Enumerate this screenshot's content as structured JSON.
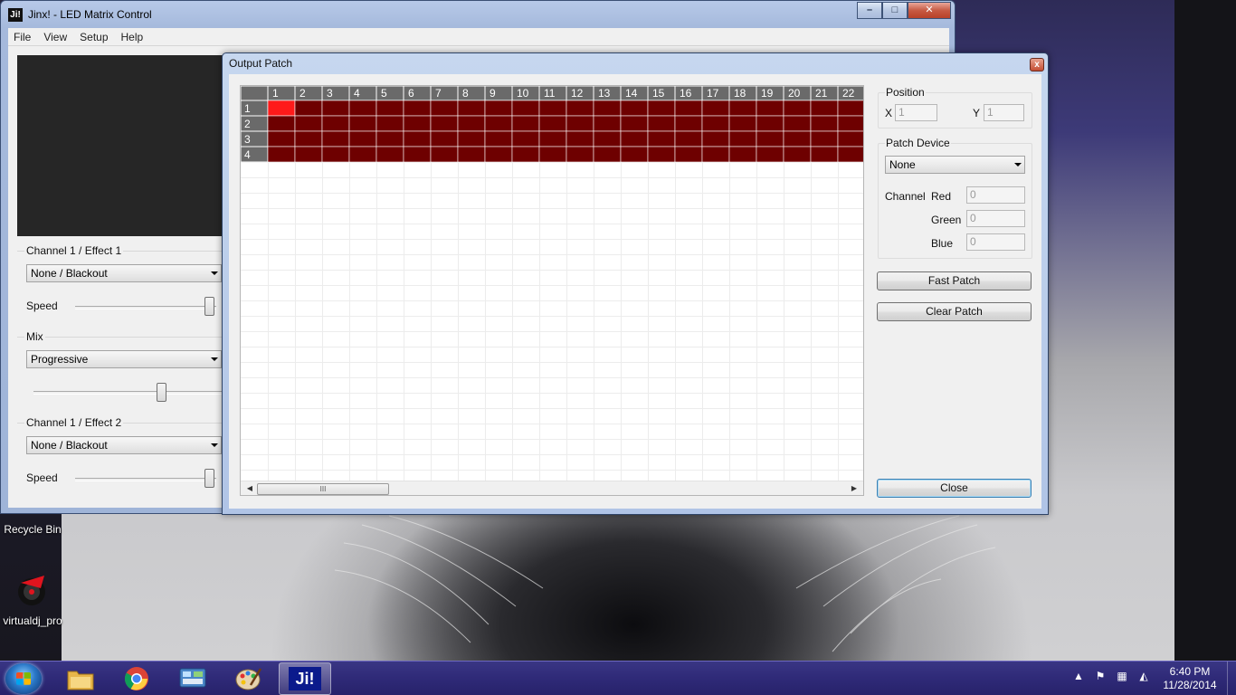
{
  "desktop": {
    "icons": [
      {
        "label": "Recycle Bin",
        "icon": "recycle-bin-icon"
      },
      {
        "label": "virtualdj_pro",
        "icon": "virtualdj-icon"
      }
    ]
  },
  "main_window": {
    "title": "Jinx! - LED Matrix Control",
    "logo_text": "Ji!",
    "menu": [
      "File",
      "View",
      "Setup",
      "Help"
    ],
    "caption": {
      "minimize": "–",
      "maximize": "□",
      "close": "✕"
    },
    "channel1": {
      "label": "Channel 1 / Effect 1",
      "effect": "None / Blackout",
      "speed_label": "Speed",
      "speed": 1.0
    },
    "mix": {
      "label": "Mix",
      "mode": "Progressive",
      "level": 0.68
    },
    "channel2": {
      "label": "Channel 1 / Effect 2",
      "effect": "None / Blackout",
      "speed_label": "Speed",
      "speed": 1.0
    }
  },
  "output_patch": {
    "title": "Output Patch",
    "close_glyph": "x",
    "grid": {
      "columns": [
        "1",
        "2",
        "3",
        "4",
        "5",
        "6",
        "7",
        "8",
        "9",
        "10",
        "11",
        "12",
        "13",
        "14",
        "15",
        "16",
        "17",
        "18",
        "19",
        "20",
        "21",
        "22"
      ],
      "rows": [
        "1",
        "2",
        "3",
        "4"
      ],
      "selected": {
        "row": 1,
        "col": 1
      },
      "cell_color": "#6e0000",
      "selected_color": "#ff1a1a",
      "header_color": "#6a6a6a"
    },
    "scroll_grip": "III",
    "position": {
      "title": "Position",
      "x_label": "X",
      "x_value": "1",
      "y_label": "Y",
      "y_value": "1"
    },
    "patch_device": {
      "title": "Patch Device",
      "device": "None",
      "channel_label": "Channel",
      "red_label": "Red",
      "red_value": "0",
      "green_label": "Green",
      "green_value": "0",
      "blue_label": "Blue",
      "blue_value": "0"
    },
    "buttons": {
      "fast_patch": "Fast Patch",
      "clear_patch": "Clear Patch",
      "close": "Close"
    }
  },
  "taskbar": {
    "apps": [
      {
        "name": "explorer",
        "icon": "folder-icon"
      },
      {
        "name": "chrome",
        "icon": "chrome-icon"
      },
      {
        "name": "control-panel",
        "icon": "control-panel-icon"
      },
      {
        "name": "paint",
        "icon": "paint-palette-icon"
      },
      {
        "name": "jinx",
        "icon": "jinx-icon",
        "label": "Ji!",
        "active": true
      }
    ],
    "clock_time": "6:40 PM",
    "clock_date": "11/28/2014"
  }
}
